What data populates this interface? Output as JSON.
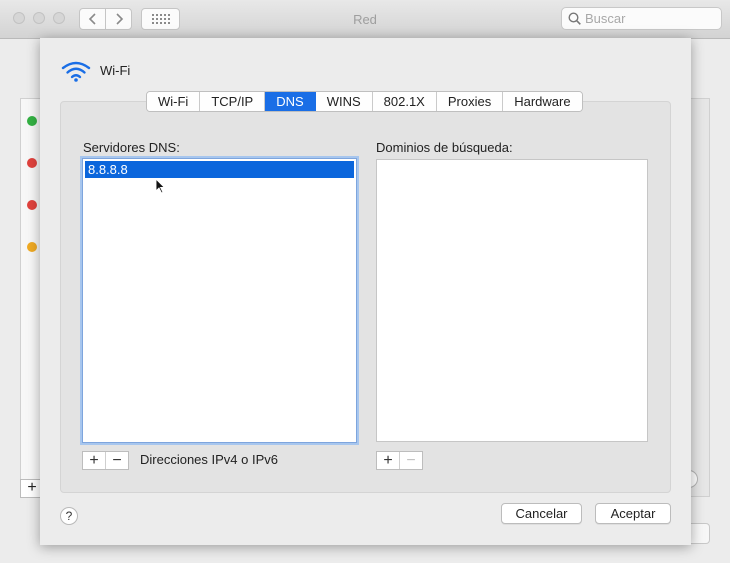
{
  "window": {
    "title": "Red"
  },
  "search": {
    "placeholder": "Buscar"
  },
  "background": {
    "status_colors": [
      "#33b143",
      "#e0423d",
      "#e0423d",
      "#f0aa23"
    ],
    "add_label": "+"
  },
  "sheet": {
    "interface": {
      "name": "Wi-Fi",
      "icon": "wifi-icon",
      "icon_color": "#1a6ee6"
    },
    "tabs": [
      {
        "label": "Wi-Fi",
        "active": false
      },
      {
        "label": "TCP/IP",
        "active": false
      },
      {
        "label": "DNS",
        "active": true
      },
      {
        "label": "WINS",
        "active": false
      },
      {
        "label": "802.1X",
        "active": false
      },
      {
        "label": "Proxies",
        "active": false
      },
      {
        "label": "Hardware",
        "active": false
      }
    ],
    "dns": {
      "label": "Servidores DNS:",
      "servers": [
        "8.8.8.8"
      ],
      "add_label": "+",
      "remove_label": "−",
      "hint": "Direcciones IPv4 o IPv6"
    },
    "search_domains": {
      "label": "Dominios de búsqueda:",
      "domains": [],
      "add_label": "+",
      "remove_label": "−"
    },
    "help_label": "?",
    "buttons": {
      "cancel": "Cancelar",
      "ok": "Aceptar"
    },
    "accent_color": "#1a6ee6"
  }
}
